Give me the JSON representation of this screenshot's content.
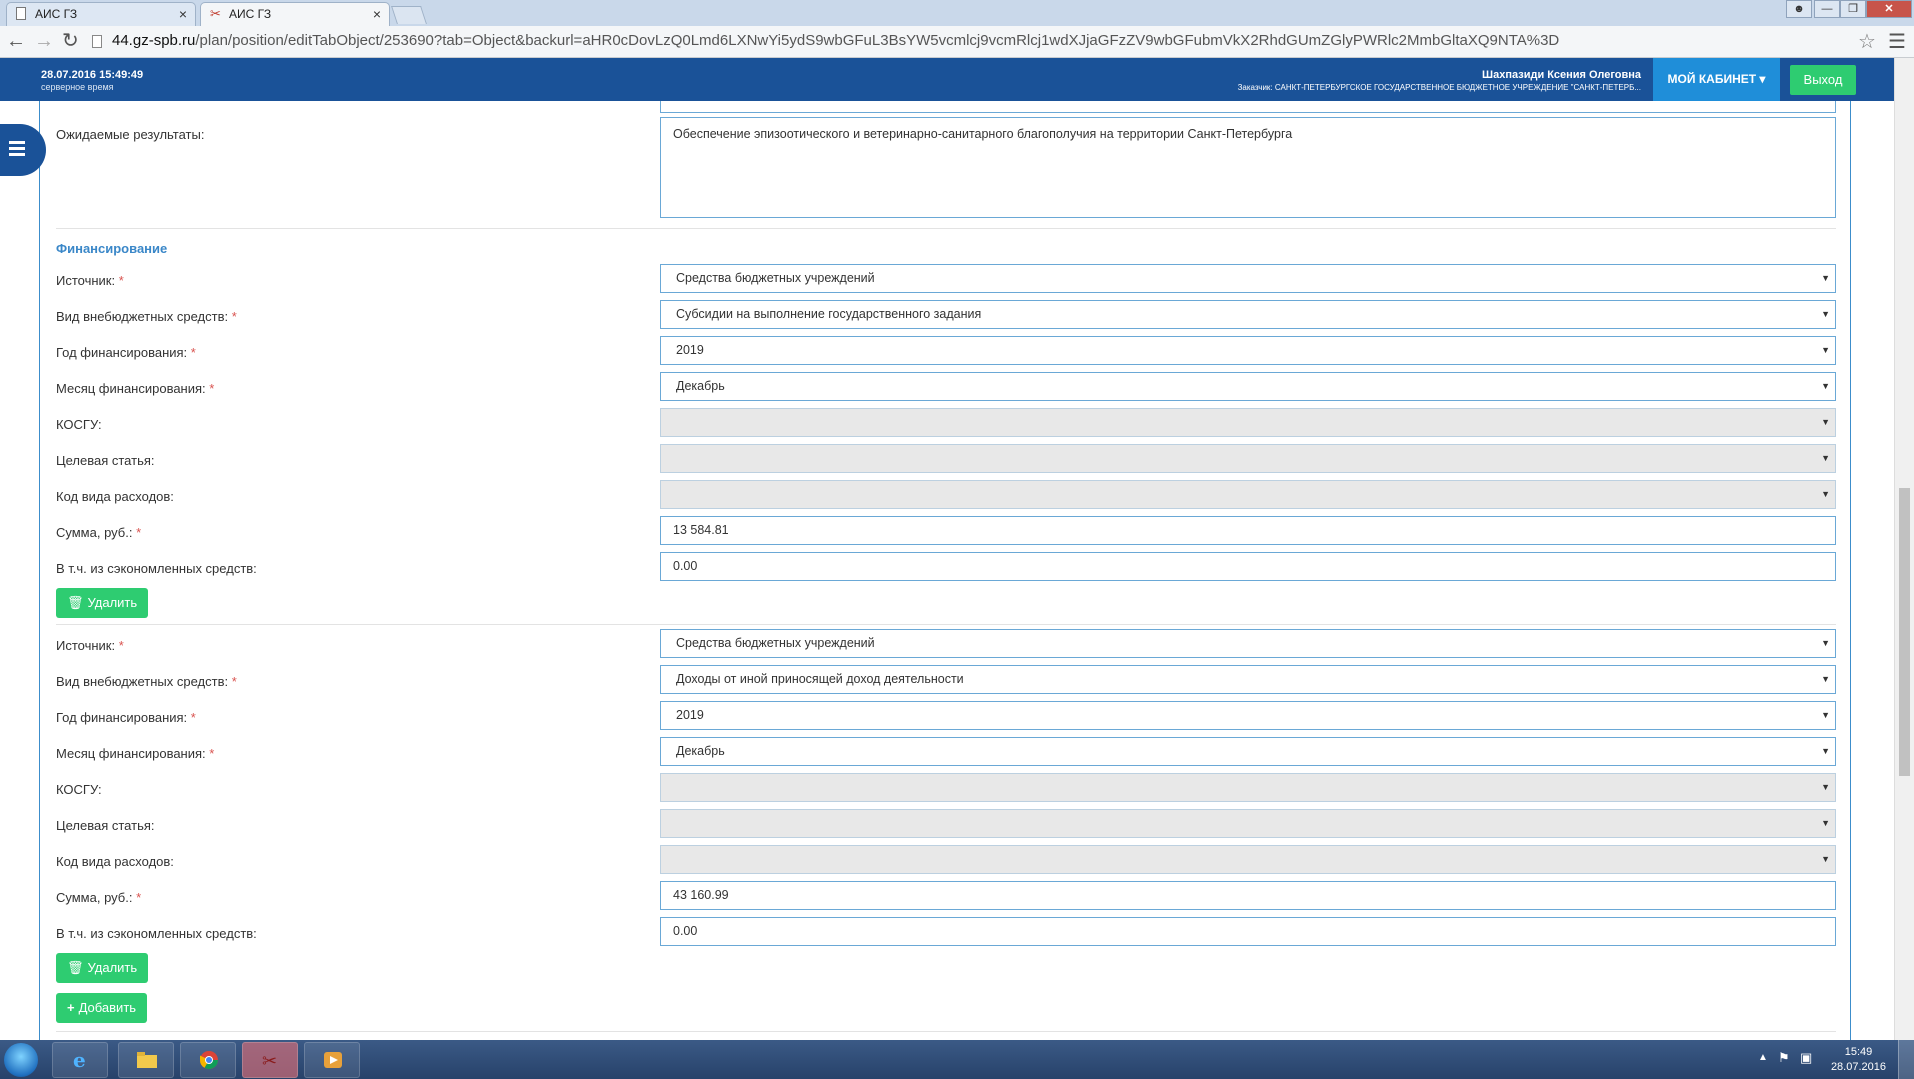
{
  "browser": {
    "tabs": [
      {
        "title": "АИС ГЗ",
        "close": "×"
      },
      {
        "title": "АИС ГЗ",
        "close": "×"
      }
    ],
    "url_host": "44.gz-spb.ru",
    "url_path": "/plan/position/editTabObject/253690?tab=Object&backurl=aHR0cDovLzQ0Lmd6LXNwYi5ydS9wbGFuL3BsYW5vcmlcj9vcmRlcj1wdXJjaGFzZV9wbGFubmVkX2RhdGUmZGlyPWRlc2MmbGltaXQ9NTA%3D"
  },
  "header": {
    "datetime": "28.07.2016 15:49:49",
    "datetime_sub": "серверное время",
    "user_name": "Шахпазиди Ксения Олеговна",
    "org": "Заказчик: САНКТ-ПЕТЕРБУРГСКОЕ ГОСУДАРСТВЕННОЕ БЮДЖЕТНОЕ УЧРЕЖДЕНИЕ \"САНКТ-ПЕТЕРБ...",
    "cabinet_label": "МОЙ КАБИНЕТ",
    "exit_label": "Выход",
    "colors": {
      "header_bg": "#1a5298",
      "cabinet_bg": "#1f8ed9",
      "exit_bg": "#2ecc71"
    }
  },
  "form": {
    "expected_label": "Ожидаемые результаты:",
    "expected_value": "Обеспечение эпизоотического и ветеринарно-санитарного благополучия на территории Санкт-Петербурга",
    "financing_title": "Финансирование",
    "labels": {
      "source": "Источник:",
      "extra_type": "Вид внебюджетных средств:",
      "year": "Год финансирования:",
      "month": "Месяц финансирования:",
      "kosgu": "КОСГУ:",
      "target": "Целевая статья:",
      "expense_code": "Код вида расходов:",
      "sum": "Сумма, руб.:",
      "saved": "В т.ч. из сэкономленных средств:",
      "required_mark": "*"
    },
    "blocks": [
      {
        "source": "Средства бюджетных учреждений",
        "extra_type": "Субсидии на выполнение государственного задания",
        "year": "2019",
        "month": "Декабрь",
        "kosgu": "",
        "target": "",
        "expense_code": "",
        "sum": "13 584.81",
        "saved": "0.00"
      },
      {
        "source": "Средства бюджетных учреждений",
        "extra_type": "Доходы от иной приносящей доход деятельности",
        "year": "2019",
        "month": "Декабрь",
        "kosgu": "",
        "target": "",
        "expense_code": "",
        "sum": "43 160.99",
        "saved": "0.00"
      }
    ],
    "delete_label": "Удалить",
    "add_label": "Добавить"
  },
  "taskbar": {
    "time": "15:49",
    "date": "28.07.2016"
  }
}
